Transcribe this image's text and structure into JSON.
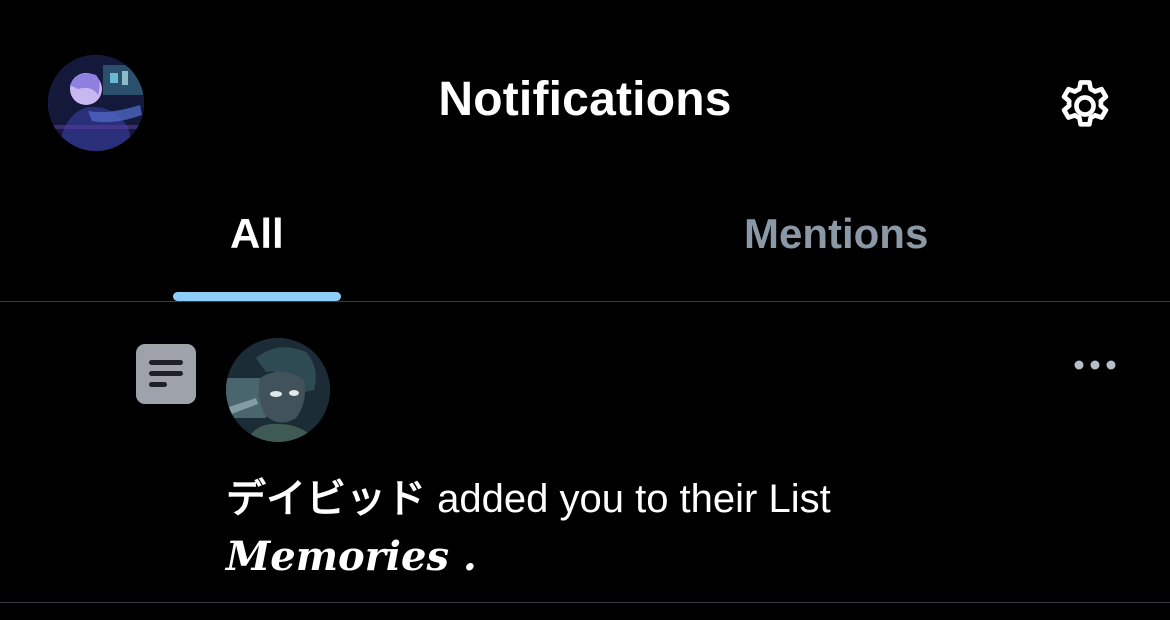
{
  "header": {
    "title": "Notifications",
    "avatar": "profile-avatar",
    "settings_icon": "gear-icon"
  },
  "tabs": [
    {
      "label": "All",
      "active": true
    },
    {
      "label": "Mentions",
      "active": false
    }
  ],
  "notification": {
    "type_icon": "list-icon",
    "user_name": "デイビッド",
    "action_text": "added you to their List",
    "list_name": "Memories",
    "trailing": " .",
    "more_icon": "more-icon"
  },
  "colors": {
    "background": "#000000",
    "tab_indicator": "#8ecdf8",
    "inactive_tab": "#8b98a5",
    "divider": "#3a3d42",
    "list_icon_bg": "#9ea3ab"
  }
}
